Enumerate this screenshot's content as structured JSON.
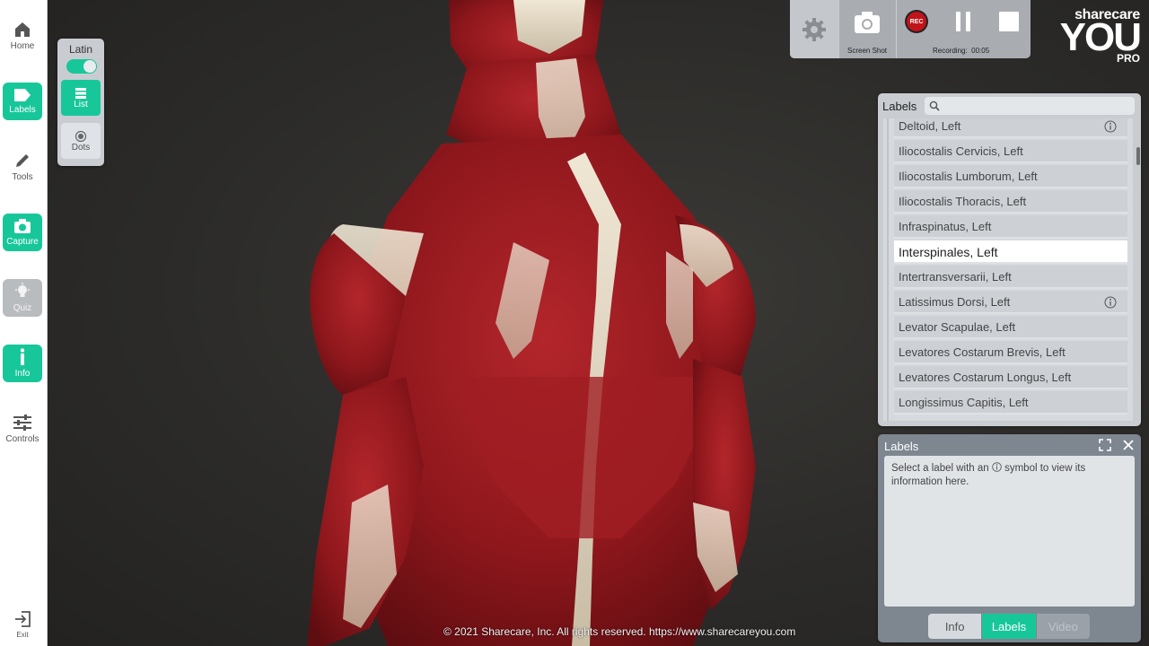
{
  "nav": {
    "home": "Home",
    "labels": "Labels",
    "tools": "Tools",
    "capture": "Capture",
    "quiz": "Quiz",
    "info": "Info",
    "controls": "Controls",
    "exit": "Exit"
  },
  "latin_panel": {
    "title": "Latin",
    "toggle_on": true,
    "list": "List",
    "dots": "Dots"
  },
  "recording": {
    "screenshot": "Screen Shot",
    "rec": "REC",
    "recording_label": "Recording:",
    "recording_time": "00:05"
  },
  "logo": {
    "brand": "sharecare",
    "you": "YOU",
    "pro": "PRO"
  },
  "labels_panel": {
    "title": "Labels",
    "search_placeholder": "",
    "items": [
      {
        "label": "Deltoid, Left",
        "has_info": true,
        "selected": false
      },
      {
        "label": "Iliocostalis Cervicis, Left",
        "has_info": false,
        "selected": false
      },
      {
        "label": "Iliocostalis Lumborum, Left",
        "has_info": false,
        "selected": false
      },
      {
        "label": "Iliocostalis Thoracis, Left",
        "has_info": false,
        "selected": false
      },
      {
        "label": "Infraspinatus, Left",
        "has_info": false,
        "selected": false
      },
      {
        "label": "Interspinales, Left",
        "has_info": false,
        "selected": true
      },
      {
        "label": "Intertransversarii, Left",
        "has_info": false,
        "selected": false
      },
      {
        "label": "Latissimus Dorsi, Left",
        "has_info": true,
        "selected": false
      },
      {
        "label": "Levator Scapulae, Left",
        "has_info": false,
        "selected": false
      },
      {
        "label": "Levatores Costarum Brevis, Left",
        "has_info": false,
        "selected": false
      },
      {
        "label": "Levatores Costarum Longus, Left",
        "has_info": false,
        "selected": false
      },
      {
        "label": "Longissimus Capitis, Left",
        "has_info": false,
        "selected": false
      }
    ]
  },
  "info_panel": {
    "title": "Labels",
    "text_before": "Select a label with an",
    "text_after": "symbol to view its information here.",
    "tabs": {
      "info": "Info",
      "labels": "Labels",
      "video": "Video"
    }
  },
  "copyright": "© 2021 Sharecare, Inc. All rights reserved. https://www.sharecareyou.com",
  "colors": {
    "accent": "#17c79a",
    "muscle": "#9b1b1f",
    "tendon": "#e8ddc8",
    "rec_red": "#c0141a"
  }
}
